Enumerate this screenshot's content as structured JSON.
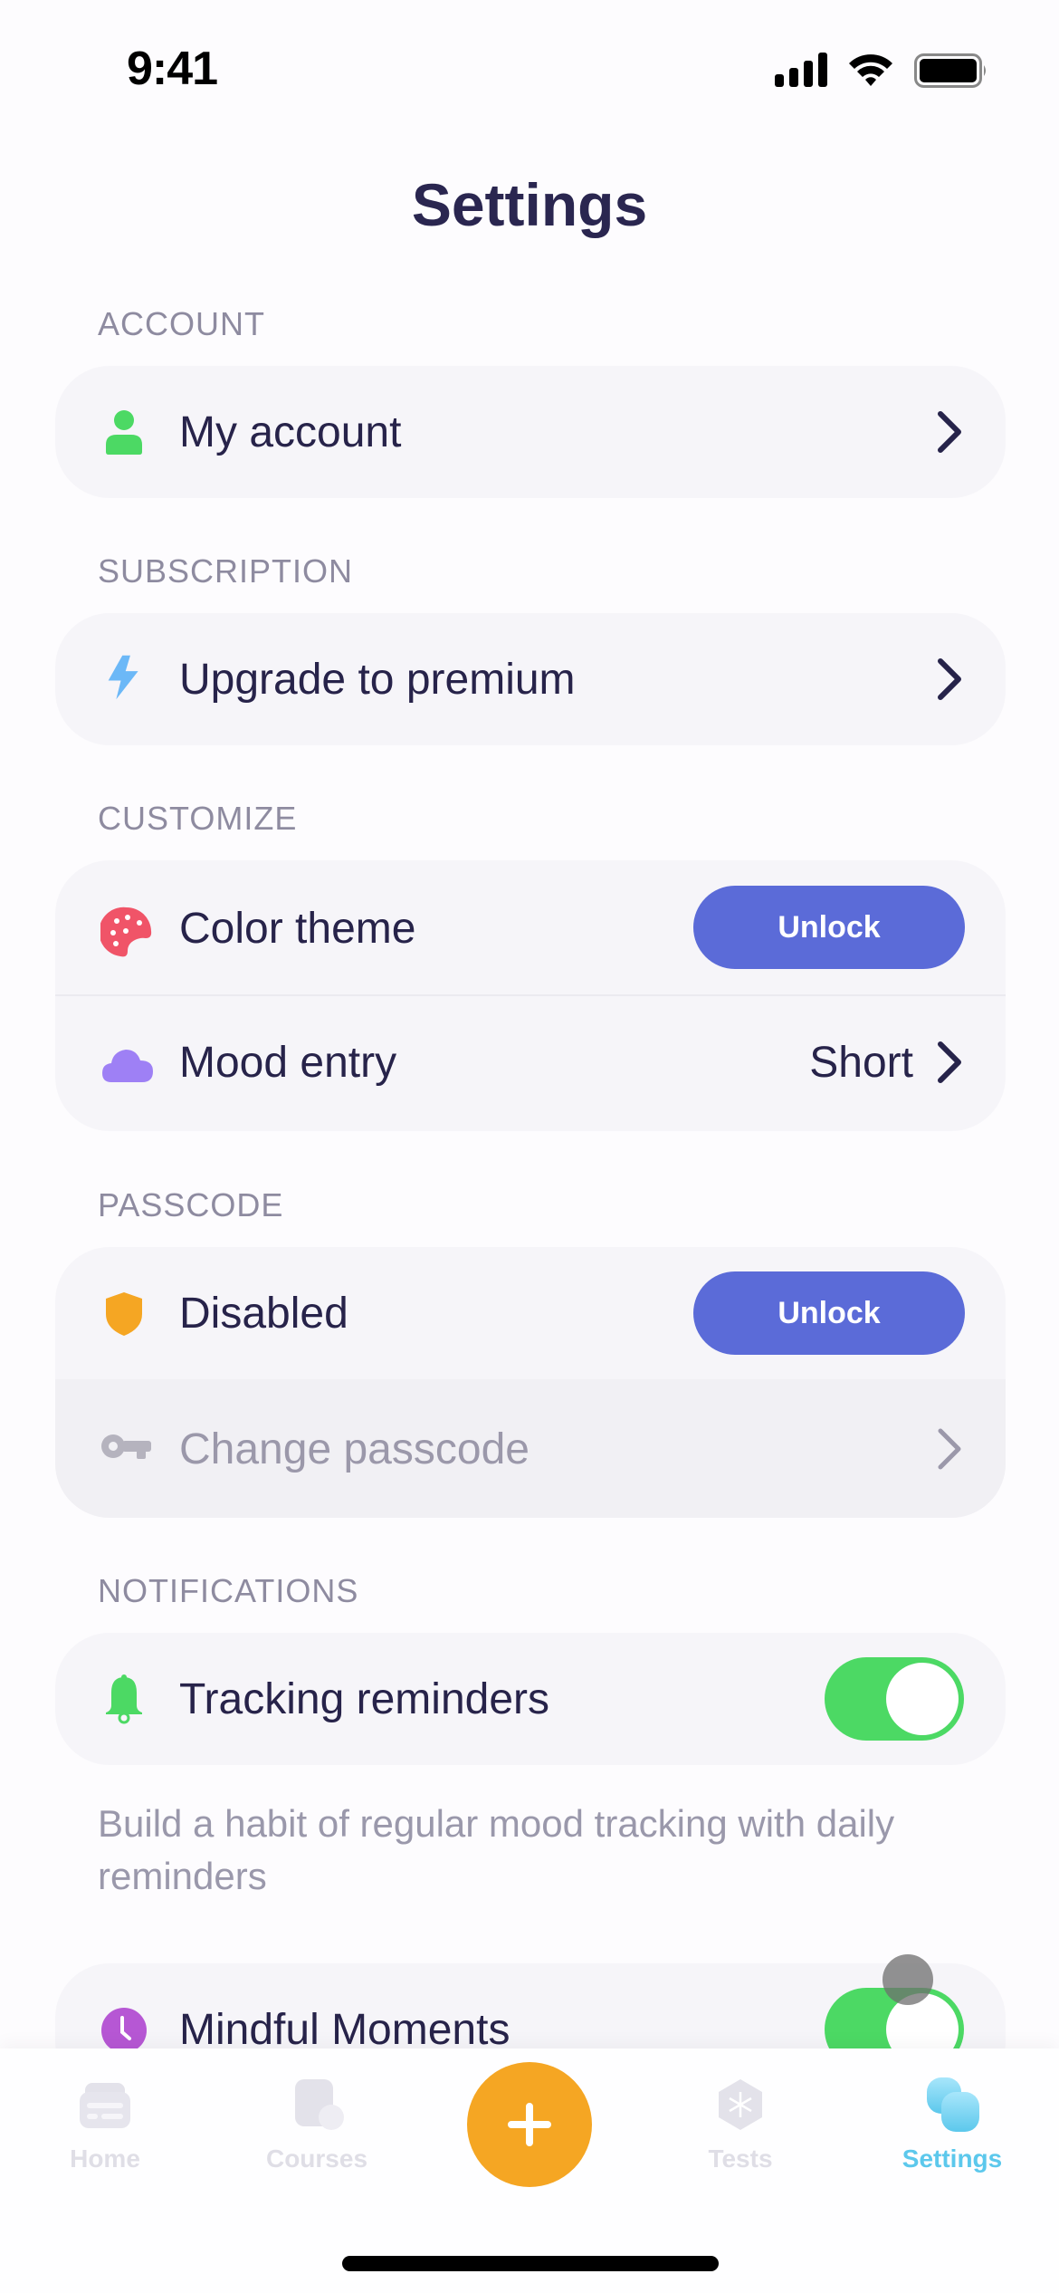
{
  "status_bar": {
    "time": "9:41",
    "icons": [
      "cellular-signal-icon",
      "wifi-icon",
      "battery-icon"
    ]
  },
  "header": {
    "title": "Settings"
  },
  "sections": {
    "account": {
      "header": "ACCOUNT",
      "items": [
        {
          "label": "My account",
          "icon": "user-icon",
          "icon_color": "#4cd964"
        }
      ]
    },
    "subscription": {
      "header": "SUBSCRIPTION",
      "items": [
        {
          "label": "Upgrade to premium",
          "icon": "lightning-icon",
          "icon_color": "#6cb8f7"
        }
      ]
    },
    "customize": {
      "header": "CUSTOMIZE",
      "items": [
        {
          "label": "Color theme",
          "icon": "palette-icon",
          "icon_color": "#f05468",
          "button": "Unlock"
        },
        {
          "label": "Mood entry",
          "icon": "cloud-icon",
          "icon_color": "#9e80f5",
          "value": "Short"
        }
      ]
    },
    "passcode": {
      "header": "PASSCODE",
      "items": [
        {
          "label": "Disabled",
          "icon": "shield-icon",
          "icon_color": "#f5a623",
          "button": "Unlock"
        },
        {
          "label": "Change passcode",
          "icon": "key-icon",
          "icon_color": "#b5b3be",
          "disabled": true
        }
      ]
    },
    "notifications": {
      "header": "NOTIFICATIONS",
      "items": [
        {
          "label": "Tracking reminders",
          "icon": "bell-icon",
          "icon_color": "#4cd964",
          "toggle": true
        },
        {
          "label": "Mindful Moments",
          "icon": "clock-icon",
          "icon_color": "#b657d4",
          "toggle": true
        }
      ],
      "description": "Build a habit of regular mood tracking with daily reminders"
    }
  },
  "tab_bar": {
    "tabs": [
      {
        "label": "Home",
        "icon": "home-icon",
        "active": false
      },
      {
        "label": "Courses",
        "icon": "courses-icon",
        "active": false
      },
      {
        "label": "Tests",
        "icon": "tests-icon",
        "active": false
      },
      {
        "label": "Settings",
        "icon": "settings-icon",
        "active": true
      }
    ],
    "add_button": "plus-icon"
  },
  "colors": {
    "accent_button": "#5b6bd8",
    "toggle_on": "#4cd964",
    "add_button": "#f5a623",
    "active_tab": "#5cc8ec",
    "title": "#2a2650"
  }
}
